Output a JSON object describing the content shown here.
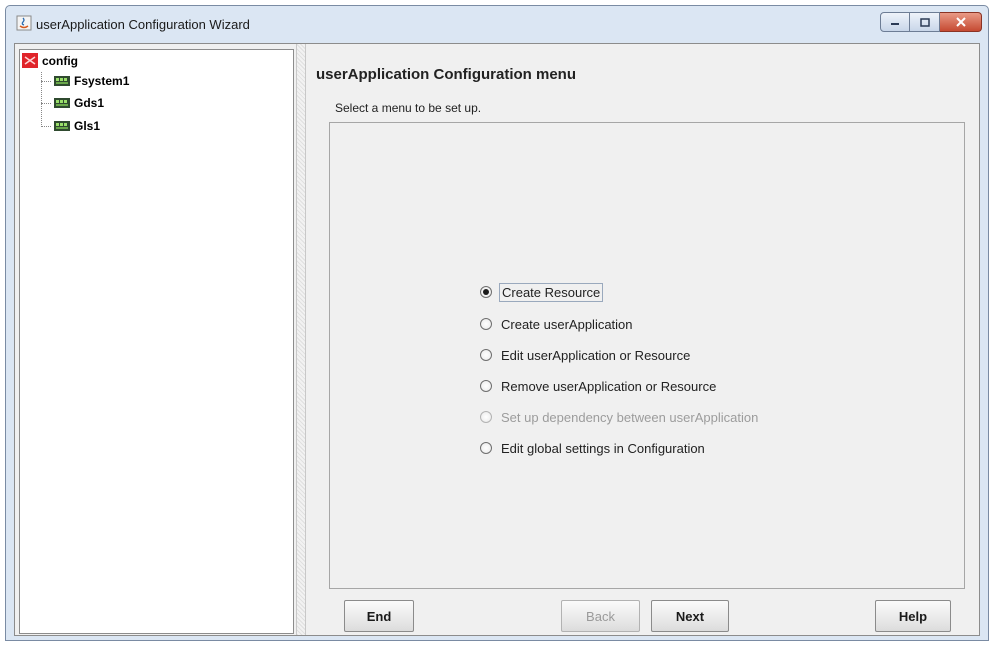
{
  "window": {
    "title": "userApplication Configuration Wizard"
  },
  "tree": {
    "root": {
      "label": "config",
      "icon": "config-folder-icon"
    },
    "children": [
      {
        "label": "Fsystem1",
        "icon": "resource-icon"
      },
      {
        "label": "Gds1",
        "icon": "resource-icon"
      },
      {
        "label": "Gls1",
        "icon": "resource-icon"
      }
    ]
  },
  "main": {
    "title": "userApplication Configuration menu",
    "subtitle": "Select a menu to be set up.",
    "options": [
      {
        "label": "Create Resource",
        "selected": true,
        "enabled": true
      },
      {
        "label": "Create userApplication",
        "selected": false,
        "enabled": true
      },
      {
        "label": "Edit userApplication or Resource",
        "selected": false,
        "enabled": true
      },
      {
        "label": "Remove userApplication or Resource",
        "selected": false,
        "enabled": true
      },
      {
        "label": "Set up dependency between userApplication",
        "selected": false,
        "enabled": false
      },
      {
        "label": "Edit global settings in Configuration",
        "selected": false,
        "enabled": true
      }
    ]
  },
  "buttons": {
    "end": "End",
    "back": "Back",
    "next": "Next",
    "help": "Help"
  },
  "colors": {
    "close_button": "#c54a32",
    "title_bar": "#dbe6f3",
    "panel_bg": "#f0f0f0"
  }
}
